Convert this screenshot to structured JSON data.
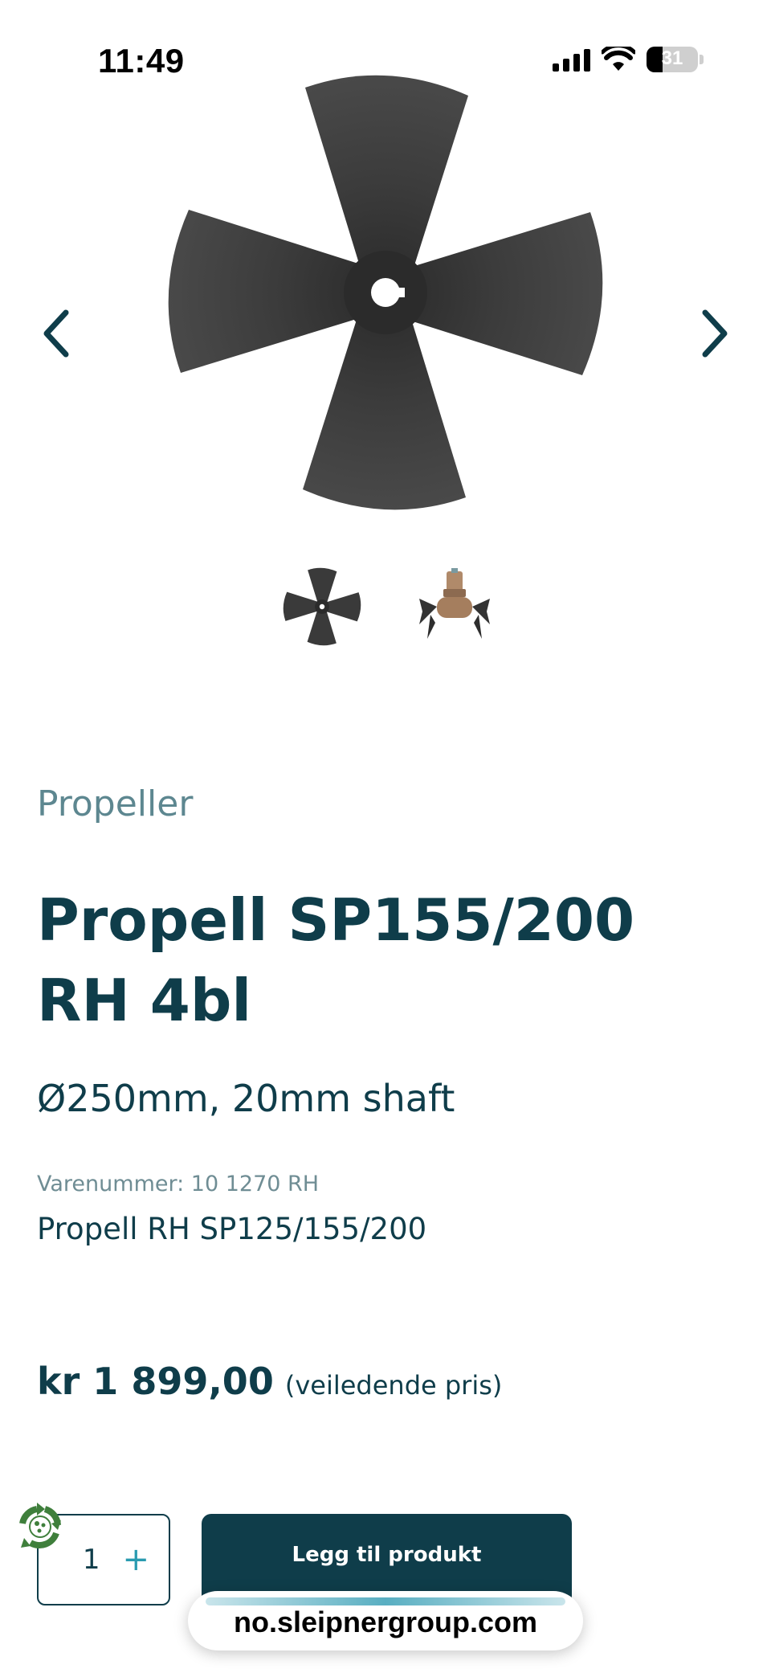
{
  "status_bar": {
    "time": "11:49",
    "battery": "31"
  },
  "gallery": {
    "main_image": "propeller-4-blade",
    "thumbnails": [
      "propeller-4-blade",
      "thruster-with-propellers"
    ]
  },
  "product": {
    "category": "Propeller",
    "title": "Propell SP155/200 RH 4bl",
    "subtitle": "Ø250mm, 20mm shaft",
    "sku_label": "Varenummer: 10 1270 RH",
    "description": "Propell RH SP125/155/200",
    "price": "kr 1 899,00",
    "price_note": "(veiledende pris)"
  },
  "purchase": {
    "quantity": "1",
    "add_button_label": "Legg til produkt"
  },
  "browser": {
    "url": "no.sleipnergroup.com"
  },
  "colors": {
    "primary": "#0f3d4a",
    "accent": "#2a9bb0",
    "muted": "#5d8790",
    "eco_green": "#3f7f3c"
  }
}
